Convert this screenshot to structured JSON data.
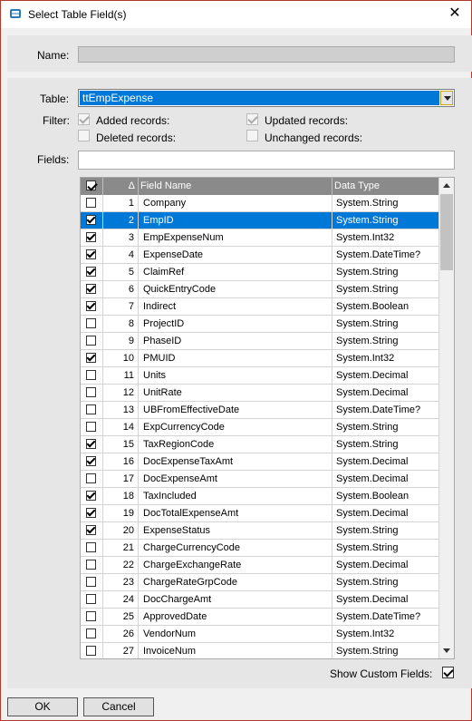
{
  "window": {
    "title": "Select Table Field(s)"
  },
  "labels": {
    "name": "Name:",
    "table": "Table:",
    "filter": "Filter:",
    "fields": "Fields:",
    "show_custom": "Show Custom Fields:"
  },
  "name_value": "",
  "table_value": "ttEmpExpense",
  "filters": [
    {
      "label": "Added records:",
      "checked": true,
      "disabled": true
    },
    {
      "label": "Updated records:",
      "checked": true,
      "disabled": true
    },
    {
      "label": "Deleted records:",
      "checked": false,
      "disabled": true
    },
    {
      "label": "Unchanged records:",
      "checked": false,
      "disabled": true
    }
  ],
  "fields_value": "",
  "grid": {
    "columns": [
      "",
      "",
      "Field Name",
      "Data Type"
    ],
    "sort_glyph": "Δ",
    "header_checked": true,
    "rows": [
      {
        "num": "1",
        "name": "Company",
        "type": "System.String",
        "checked": false,
        "selected": false
      },
      {
        "num": "2",
        "name": "EmpID",
        "type": "System.String",
        "checked": true,
        "selected": true
      },
      {
        "num": "3",
        "name": "EmpExpenseNum",
        "type": "System.Int32",
        "checked": true,
        "selected": false
      },
      {
        "num": "4",
        "name": "ExpenseDate",
        "type": "System.DateTime?",
        "checked": true,
        "selected": false
      },
      {
        "num": "5",
        "name": "ClaimRef",
        "type": "System.String",
        "checked": true,
        "selected": false
      },
      {
        "num": "6",
        "name": "QuickEntryCode",
        "type": "System.String",
        "checked": true,
        "selected": false
      },
      {
        "num": "7",
        "name": "Indirect",
        "type": "System.Boolean",
        "checked": true,
        "selected": false
      },
      {
        "num": "8",
        "name": "ProjectID",
        "type": "System.String",
        "checked": false,
        "selected": false
      },
      {
        "num": "9",
        "name": "PhaseID",
        "type": "System.String",
        "checked": false,
        "selected": false
      },
      {
        "num": "10",
        "name": "PMUID",
        "type": "System.Int32",
        "checked": true,
        "selected": false
      },
      {
        "num": "11",
        "name": "Units",
        "type": "System.Decimal",
        "checked": false,
        "selected": false
      },
      {
        "num": "12",
        "name": "UnitRate",
        "type": "System.Decimal",
        "checked": false,
        "selected": false
      },
      {
        "num": "13",
        "name": "UBFromEffectiveDate",
        "type": "System.DateTime?",
        "checked": false,
        "selected": false
      },
      {
        "num": "14",
        "name": "ExpCurrencyCode",
        "type": "System.String",
        "checked": false,
        "selected": false
      },
      {
        "num": "15",
        "name": "TaxRegionCode",
        "type": "System.String",
        "checked": true,
        "selected": false
      },
      {
        "num": "16",
        "name": "DocExpenseTaxAmt",
        "type": "System.Decimal",
        "checked": true,
        "selected": false
      },
      {
        "num": "17",
        "name": "DocExpenseAmt",
        "type": "System.Decimal",
        "checked": false,
        "selected": false
      },
      {
        "num": "18",
        "name": "TaxIncluded",
        "type": "System.Boolean",
        "checked": true,
        "selected": false
      },
      {
        "num": "19",
        "name": "DocTotalExpenseAmt",
        "type": "System.Decimal",
        "checked": true,
        "selected": false
      },
      {
        "num": "20",
        "name": "ExpenseStatus",
        "type": "System.String",
        "checked": true,
        "selected": false
      },
      {
        "num": "21",
        "name": "ChargeCurrencyCode",
        "type": "System.String",
        "checked": false,
        "selected": false
      },
      {
        "num": "22",
        "name": "ChargeExchangeRate",
        "type": "System.Decimal",
        "checked": false,
        "selected": false
      },
      {
        "num": "23",
        "name": "ChargeRateGrpCode",
        "type": "System.String",
        "checked": false,
        "selected": false
      },
      {
        "num": "24",
        "name": "DocChargeAmt",
        "type": "System.Decimal",
        "checked": false,
        "selected": false
      },
      {
        "num": "25",
        "name": "ApprovedDate",
        "type": "System.DateTime?",
        "checked": false,
        "selected": false
      },
      {
        "num": "26",
        "name": "VendorNum",
        "type": "System.Int32",
        "checked": false,
        "selected": false
      },
      {
        "num": "27",
        "name": "InvoiceNum",
        "type": "System.String",
        "checked": false,
        "selected": false
      }
    ]
  },
  "show_custom_checked": true,
  "buttons": {
    "ok": "OK",
    "cancel": "Cancel"
  },
  "colors": {
    "selection": "#0078d7",
    "header": "#8a8a8a",
    "window_border": "#b13a2d"
  },
  "icons": {
    "app": "table-app-icon",
    "close": "close-icon",
    "dropdown": "chevron-down-icon"
  }
}
